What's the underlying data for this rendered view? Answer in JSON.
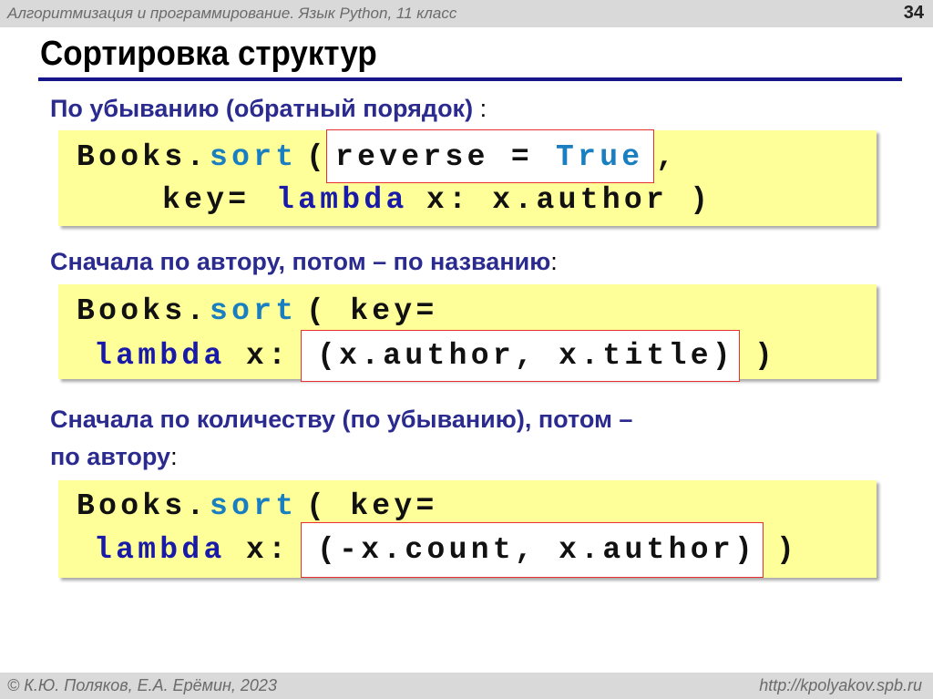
{
  "header": {
    "course": "Алгоритмизация и программирование. Язык Python, 11 класс",
    "page": "34"
  },
  "title": "Сортировка структур",
  "sections": [
    {
      "heading": "По убыванию (обратный порядок)",
      "heading_suffix": " :",
      "code": {
        "obj": "Books.",
        "method": "sort",
        "open": "(",
        "highlight_a": "reverse = ",
        "highlight_b": "True",
        "comma": ",",
        "key": "key=",
        "kw": "lambda",
        "rest": "x: x.author )"
      }
    },
    {
      "heading": "Сначала по автору, потом – по названию",
      "heading_suffix": ":",
      "code": {
        "obj": "Books.",
        "method": "sort",
        "open": "( key=",
        "kw": "lambda",
        "arg": "x:",
        "highlight": "(x.author, x.title)",
        "close": ")"
      }
    },
    {
      "heading": "Сначала по количеству (по убыванию), потом –",
      "heading2": "по автору",
      "heading_suffix": ":",
      "code": {
        "obj": "Books.",
        "method": "sort",
        "open": "( key=",
        "kw": "lambda",
        "arg": "x:",
        "highlight": "(-x.count, x.author)",
        "close": ")"
      }
    }
  ],
  "footer": {
    "authors": "© К.Ю. Поляков, Е.А. Ерёмин, 2023",
    "url": "http://kpolyakov.spb.ru"
  }
}
